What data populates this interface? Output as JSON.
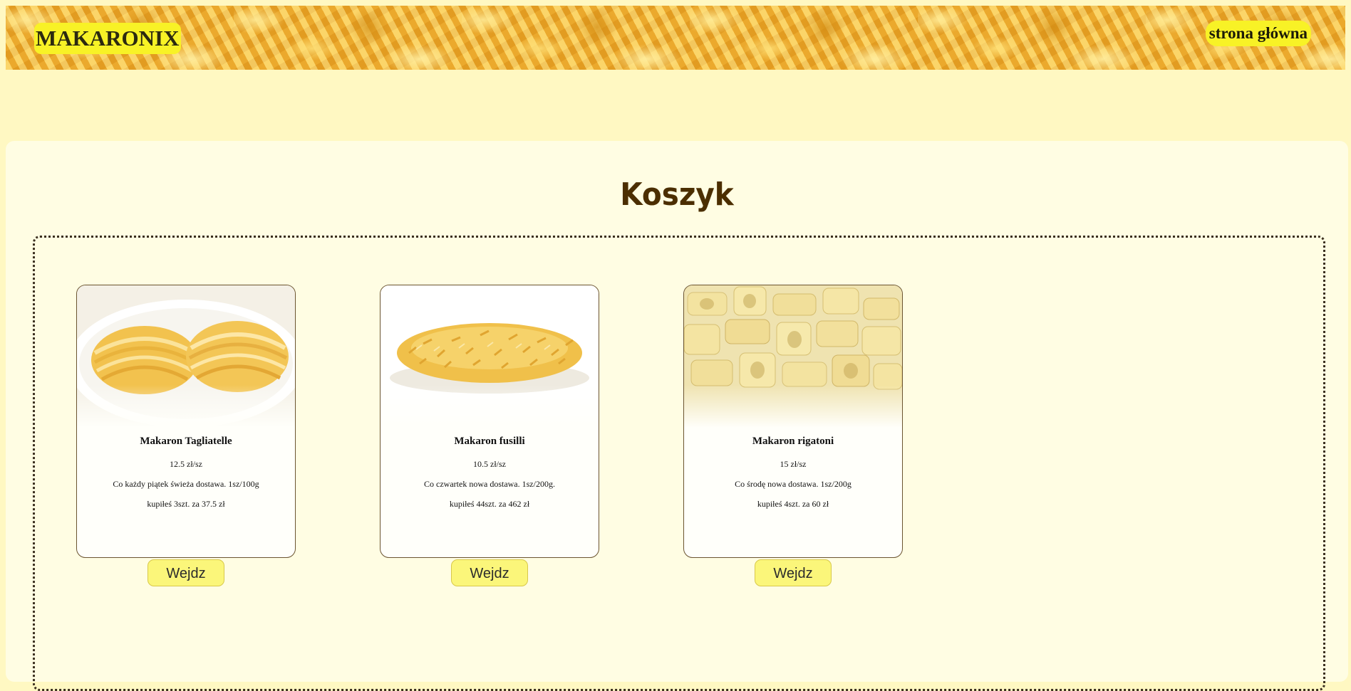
{
  "header": {
    "logo": "MAKARONIX",
    "home_link": "strona główna"
  },
  "main": {
    "title": "Koszyk"
  },
  "cart_items": [
    {
      "name": "Makaron Tagliatelle",
      "price": "12.5 zł/sz",
      "description": "Co każdy piątek świeża dostawa. 1sz/100g",
      "bought": "kupiłeś 3szt. za 37.5 zł",
      "button": "Wejdz"
    },
    {
      "name": "Makaron fusilli",
      "price": "10.5 zł/sz",
      "description": "Co czwartek nowa dostawa. 1sz/200g.",
      "bought": "kupiłeś 44szt. za 462 zł",
      "button": "Wejdz"
    },
    {
      "name": "Makaron rigatoni",
      "price": "15 zł/sz",
      "description": "Co środę nowa dostawa. 1sz/200g",
      "bought": "kupiłeś 4szt. za 60 zł",
      "button": "Wejdz"
    }
  ],
  "colors": {
    "background": "#fff8c2",
    "panel": "#fffde3",
    "highlight": "#f8f226",
    "title": "#4b2e00",
    "button": "#fbf67a"
  }
}
